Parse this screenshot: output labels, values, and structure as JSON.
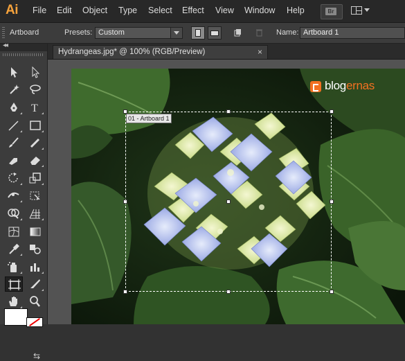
{
  "app": {
    "logo": "Ai"
  },
  "menu": [
    "File",
    "Edit",
    "Object",
    "Type",
    "Select",
    "Effect",
    "View",
    "Window",
    "Help"
  ],
  "menubar_right": {
    "bridge_button": "Br",
    "workspace_icon": "workspace-switcher-icon"
  },
  "controlbar": {
    "tool_name": "Artboard",
    "presets_label": "Presets:",
    "presets_value": "Custom",
    "name_label": "Name:",
    "name_value": "Artboard 1"
  },
  "document_tab": {
    "title": "Hydrangeas.jpg* @ 100% (RGB/Preview)",
    "close": "×"
  },
  "tools_panel": {
    "collapse": "◂◂"
  },
  "canvas": {
    "artboard_label": "01 - Artboard 1",
    "watermark": {
      "part1": "blog",
      "part2": "ernas",
      "accent": "#f37021"
    }
  },
  "colors": {
    "ui_bg": "#323232",
    "menubar": "#282828",
    "accent_logo": "#f7a33c"
  }
}
